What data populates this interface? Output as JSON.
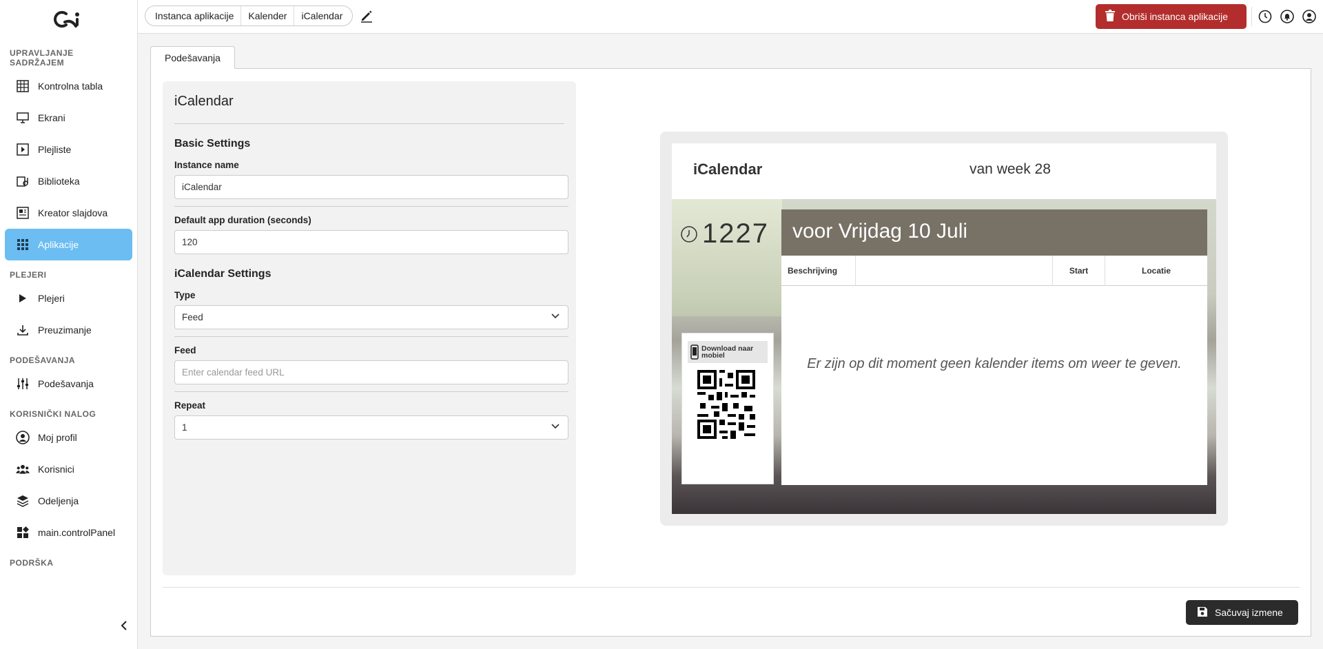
{
  "sidebar": {
    "sections": {
      "content": "UPRAVLJANJE SADRŽAJEM",
      "players": "PLEJERI",
      "settings": "PODEŠAVANJA",
      "account": "KORISNIČKI NALOG",
      "support": "PODRŠKA"
    },
    "items": {
      "dashboard": "Kontrolna tabla",
      "screens": "Ekrani",
      "playlists": "Plejliste",
      "library": "Biblioteka",
      "slide_creator": "Kreator slajdova",
      "applications": "Aplikacije",
      "players": "Plejeri",
      "download": "Preuzimanje",
      "settings": "Podešavanja",
      "profile": "Moj profil",
      "users": "Korisnici",
      "departments": "Odeljenja",
      "control_panel": "main.controlPanel"
    }
  },
  "topbar": {
    "breadcrumb": [
      "Instanca aplikacije",
      "Kalender",
      "iCalendar"
    ],
    "delete_label": "Obriši instanca aplikacije"
  },
  "tabs": {
    "settings": "Podešavanja"
  },
  "form": {
    "title": "iCalendar",
    "basic_heading": "Basic Settings",
    "instance_name_label": "Instance name",
    "instance_name_value": "iCalendar",
    "duration_label": "Default app duration (seconds)",
    "duration_value": "120",
    "ical_heading": "iCalendar Settings",
    "type_label": "Type",
    "type_value": "Feed",
    "feed_label": "Feed",
    "feed_placeholder": "Enter calendar feed URL",
    "repeat_label": "Repeat",
    "repeat_value": "1"
  },
  "preview": {
    "title": "iCalendar",
    "week": "van week 28",
    "time": "1227",
    "day_heading": "voor Vrijdag 10 Juli",
    "col_description": "Beschrijving",
    "col_start": "Start",
    "col_location": "Locatie",
    "empty_message": "Er zijn op dit moment geen kalender items om weer te geven.",
    "qr_label": "Download naar mobiel"
  },
  "footer": {
    "save_label": "Sačuvaj izmene"
  },
  "colors": {
    "accent": "#6bbdf2",
    "danger": "#b32d2d",
    "dark_button": "#2b2b2b",
    "preview_head": "#777166"
  }
}
